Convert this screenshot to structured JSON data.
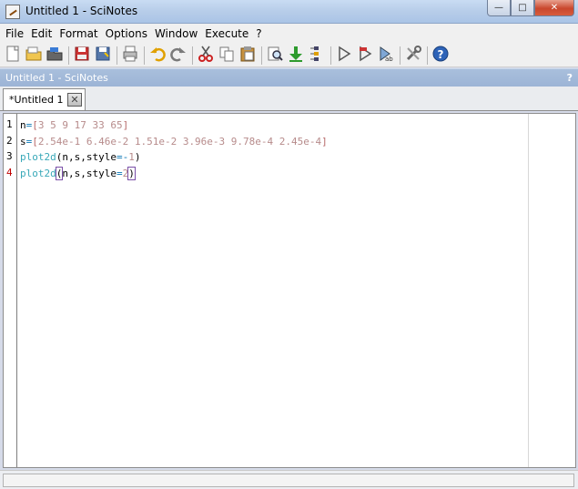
{
  "window": {
    "title": "Untitled 1 - SciNotes",
    "minimize_glyph": "—",
    "maximize_glyph": "□",
    "close_glyph": "✕"
  },
  "menu": [
    "File",
    "Edit",
    "Format",
    "Options",
    "Window",
    "Execute",
    "?"
  ],
  "toolbar": [
    {
      "name": "new-file-icon"
    },
    {
      "name": "open-file-icon"
    },
    {
      "name": "open-folder-icon"
    },
    "sep",
    {
      "name": "save-icon"
    },
    {
      "name": "save-as-icon"
    },
    "sep",
    {
      "name": "print-icon"
    },
    "sep",
    {
      "name": "undo-icon"
    },
    {
      "name": "redo-icon"
    },
    "sep",
    {
      "name": "cut-icon"
    },
    {
      "name": "copy-icon"
    },
    {
      "name": "paste-icon"
    },
    "sep",
    {
      "name": "find-icon"
    },
    {
      "name": "load-into-scilab-icon"
    },
    {
      "name": "execute-file-icon"
    },
    "sep",
    {
      "name": "execute-icon"
    },
    {
      "name": "execute-until-caret-icon"
    },
    {
      "name": "execute-with-echo-icon"
    },
    "sep",
    {
      "name": "preferences-icon"
    },
    "sep",
    {
      "name": "help-icon"
    }
  ],
  "dock": {
    "title": "Untitled 1 - SciNotes",
    "help": "?"
  },
  "tab": {
    "label": "*Untitled 1",
    "close": "✕"
  },
  "editor": {
    "line_numbers": [
      "1",
      "2",
      "3",
      "4"
    ],
    "active_line": 4,
    "lines": [
      [
        [
          "var",
          "n"
        ],
        [
          "op",
          "="
        ],
        [
          "br",
          "["
        ],
        [
          "num",
          "3 5 9 17 33 65"
        ],
        [
          "br",
          "]"
        ]
      ],
      [
        [
          "var",
          "s"
        ],
        [
          "op",
          "="
        ],
        [
          "br",
          "["
        ],
        [
          "num",
          "2.54e-1 6.46e-2 1.51e-2 3.96e-3 9.78e-4 2.45e-4"
        ],
        [
          "br",
          "]"
        ]
      ],
      [
        [
          "fn",
          "plot2d"
        ],
        [
          "kw",
          "(n,s,style"
        ],
        [
          "op",
          "=-"
        ],
        [
          "num",
          "1"
        ],
        [
          "kw",
          ")"
        ]
      ],
      [
        [
          "fn",
          "plot2d"
        ],
        [
          "hl",
          "("
        ],
        [
          "kw",
          "n,s,style"
        ],
        [
          "op",
          "="
        ],
        [
          "num",
          "2"
        ],
        [
          "hl",
          ")"
        ]
      ]
    ]
  }
}
